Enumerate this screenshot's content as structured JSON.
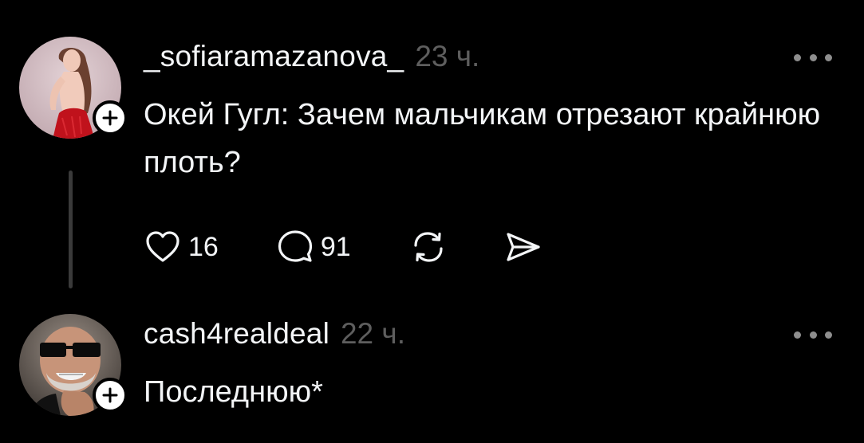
{
  "posts": [
    {
      "username": "_sofiaramazanova_",
      "time": "23 ч.",
      "text": "Окей Гугл: Зачем мальчикам отрезают крайнюю плоть?",
      "likes": "16",
      "replies": "91",
      "avatar_icon": "woman-red-dress-avatar"
    },
    {
      "username": "cash4realdeal",
      "time": "22 ч.",
      "text": "Последнюю*",
      "avatar_icon": "man-sunglasses-avatar"
    }
  ],
  "icons": {
    "like": "heart-icon",
    "reply": "speech-bubble-icon",
    "repost": "repost-arrows-icon",
    "share": "send-arrow-icon",
    "follow": "plus-icon",
    "more": "ellipsis-icon"
  },
  "colors": {
    "background": "#000000",
    "text_primary": "#f3f5f7",
    "text_secondary": "#5e5e5e",
    "thread_line": "#3a3a3a",
    "badge": "#ffffff"
  }
}
